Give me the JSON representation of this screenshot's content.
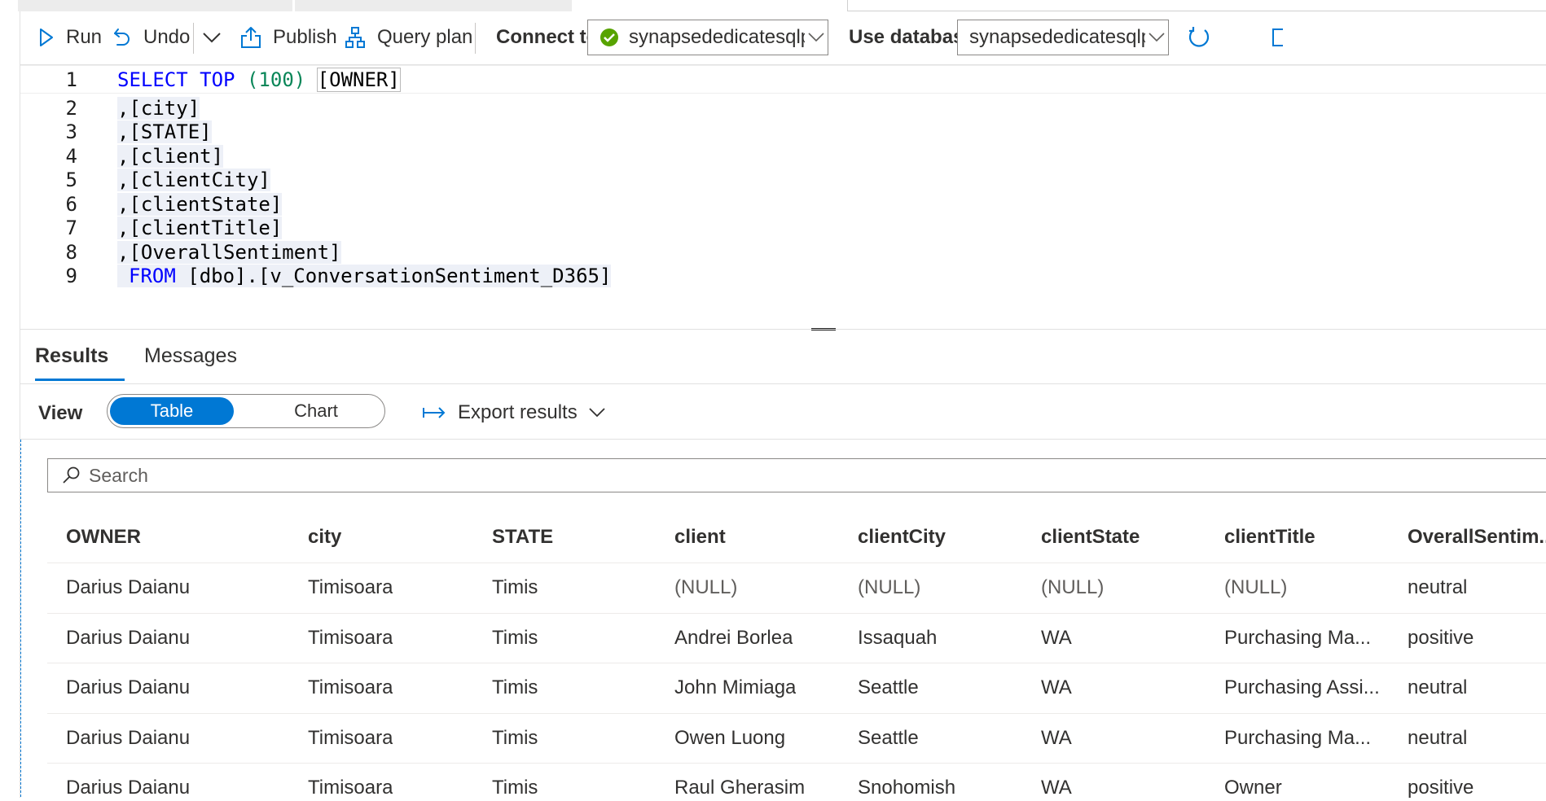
{
  "toolbar": {
    "run_label": "Run",
    "undo_label": "Undo",
    "publish_label": "Publish",
    "query_plan_label": "Query plan",
    "connect_to_label": "Connect to",
    "connect_to_value": "synapsededicatesqlpool",
    "use_database_label": "Use database",
    "use_database_value": "synapsededicatesqlpool",
    "colors": {
      "accent": "#0078d4",
      "success": "#57a300"
    }
  },
  "editor": {
    "line_numbers": [
      "1",
      "2",
      "3",
      "4",
      "5",
      "6",
      "7",
      "8",
      "9"
    ],
    "lines": {
      "l1_kw1": "SELECT",
      "l1_kw2": "TOP",
      "l1_num": "(100)",
      "l1_col": "[OWNER]",
      "l2": ",[city]",
      "l3": ",[STATE]",
      "l4": ",[client]",
      "l5": ",[clientCity]",
      "l6": ",[clientState]",
      "l7": ",[clientTitle]",
      "l8": ",[OverallSentiment]",
      "l9_kw": "FROM",
      "l9_rest": "[dbo].[v_ConversationSentiment_D365]"
    }
  },
  "results": {
    "tabs": [
      "Results",
      "Messages"
    ],
    "view_label": "View",
    "view_options": [
      "Table",
      "Chart"
    ],
    "export_label": "Export results",
    "search_placeholder": "Search",
    "columns": [
      "OWNER",
      "city",
      "STATE",
      "client",
      "clientCity",
      "clientState",
      "clientTitle",
      "OverallSentim..."
    ],
    "rows": [
      [
        "Darius Daianu",
        "Timisoara",
        "Timis",
        "(NULL)",
        "(NULL)",
        "(NULL)",
        "(NULL)",
        "neutral"
      ],
      [
        "Darius Daianu",
        "Timisoara",
        "Timis",
        "Andrei Borlea",
        "Issaquah",
        "WA",
        "Purchasing Ma...",
        "positive"
      ],
      [
        "Darius Daianu",
        "Timisoara",
        "Timis",
        "John Mimiaga",
        "Seattle",
        "WA",
        "Purchasing Assi...",
        "neutral"
      ],
      [
        "Darius Daianu",
        "Timisoara",
        "Timis",
        "Owen Luong",
        "Seattle",
        "WA",
        "Purchasing Ma...",
        "neutral"
      ],
      [
        "Darius Daianu",
        "Timisoara",
        "Timis",
        "Raul Gherasim",
        "Snohomish",
        "WA",
        "Owner",
        "positive"
      ]
    ]
  }
}
